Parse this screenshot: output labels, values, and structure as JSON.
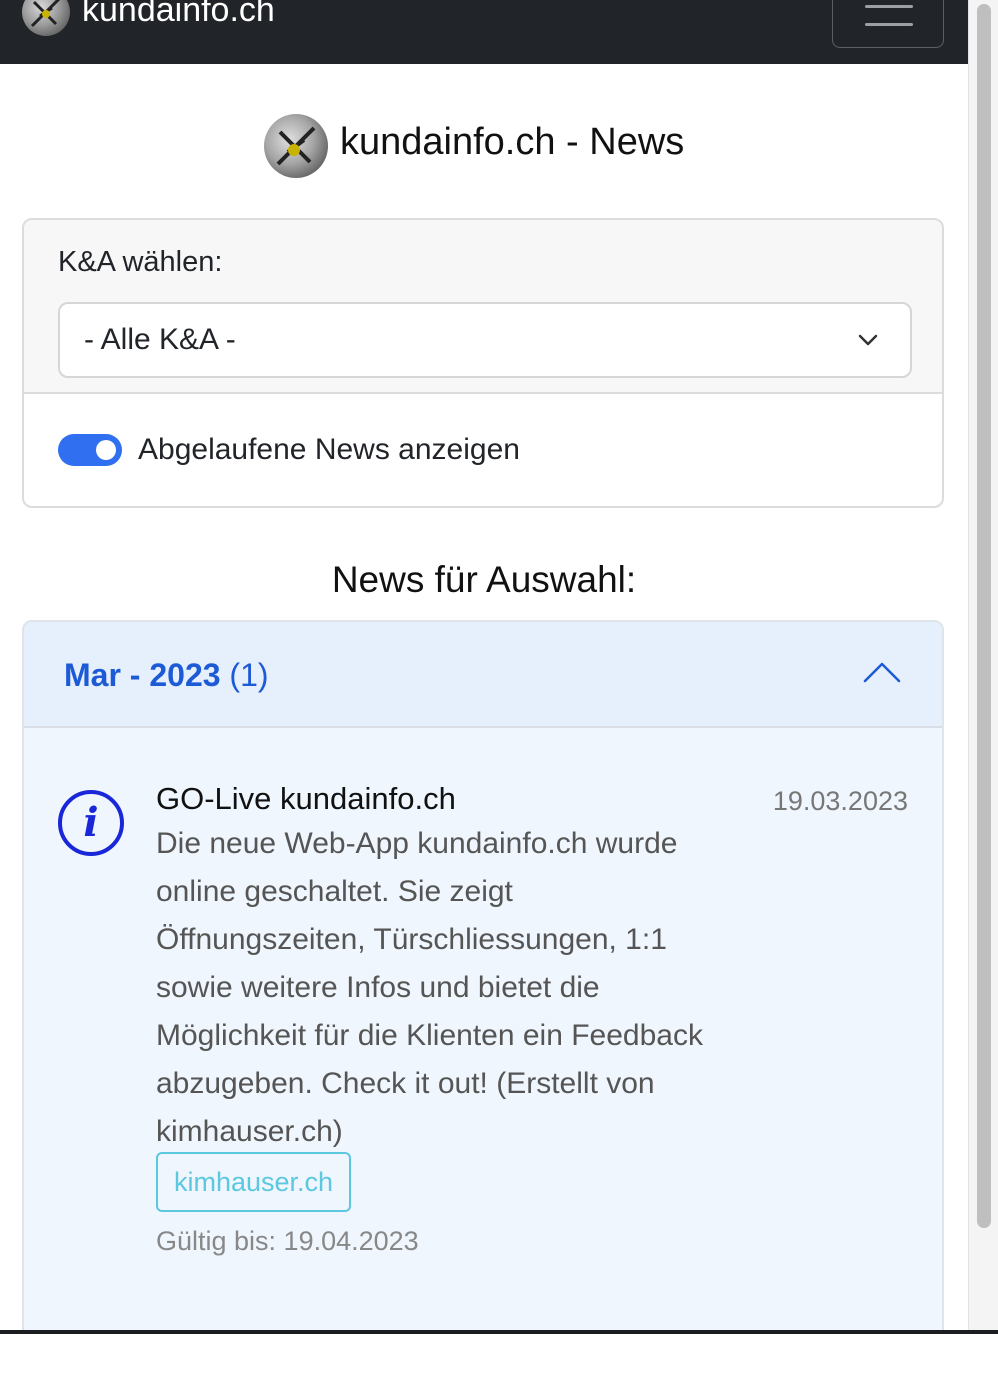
{
  "navbar": {
    "brand": "kundainfo.ch"
  },
  "header": {
    "title": "kundainfo.ch - News"
  },
  "filter": {
    "label": "K&A wählen:",
    "selected": "- Alle K&A -",
    "toggle_label": "Abgelaufene News anzeigen",
    "toggle_on": true
  },
  "section_title": "News für Auswahl:",
  "accordion": {
    "month": "Mar - 2023",
    "count": "(1)",
    "expanded": true,
    "items": [
      {
        "title": "GO-Live kundainfo.ch",
        "date": "19.03.2023",
        "body_lines": [
          "Die neue Web-App kundainfo.ch wurde",
          "online geschaltet. Sie zeigt",
          "Öffnungszeiten, Türschliessungen, 1:1",
          "sowie weitere Infos und bietet die",
          "Möglichkeit für die Klienten ein Feedback",
          "abzugeben. Check it out! (Erstellt von",
          "kimhauser.ch)"
        ],
        "link": "kimhauser.ch",
        "valid_until": "Gültig bis: 19.04.2023",
        "icon": "info-icon"
      }
    ]
  },
  "colors": {
    "accent": "#2f6ff0",
    "accordion_title": "#1d5bd6",
    "info_icon": "#1a27d8",
    "link": "#5bc8e0",
    "navbar": "#212529"
  }
}
